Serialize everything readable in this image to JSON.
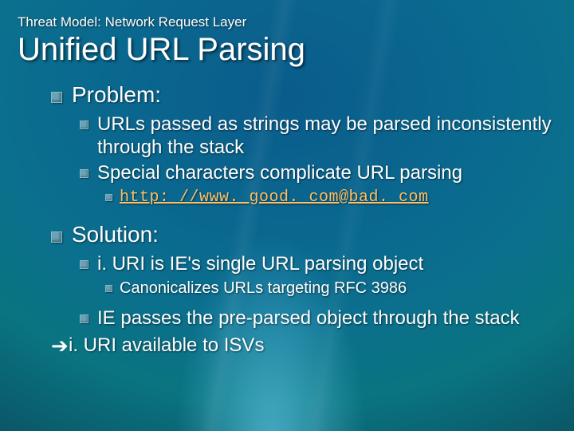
{
  "pretitle": "Threat Model: Network Request Layer",
  "title": "Unified URL Parsing",
  "sections": {
    "problem": {
      "heading": "Problem:",
      "points": [
        "URLs passed as strings may be parsed inconsistently through the stack",
        "Special characters complicate URL parsing"
      ],
      "example_url": "http: //www. good. com@bad. com"
    },
    "solution": {
      "heading": "Solution:",
      "points": [
        "i. URI is IE's single URL parsing object",
        "IE passes the pre-parsed object through the stack"
      ],
      "subpoint": "Canonicalizes URLs targeting RFC 3986",
      "availability": "i. URI available to ISVs",
      "arrow": "➔"
    }
  }
}
